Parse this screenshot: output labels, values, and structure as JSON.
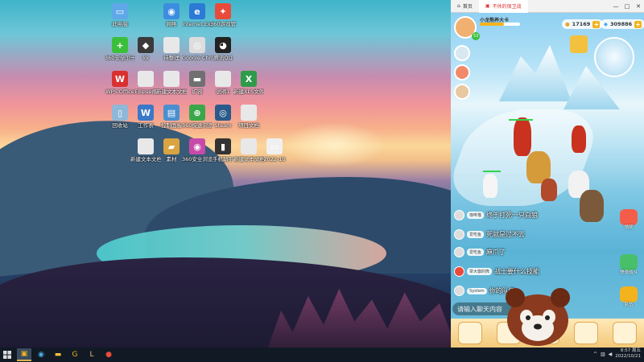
{
  "desktop": {
    "icons": [
      {
        "label": "此电脑",
        "color": "#5fa8e8",
        "glyph": "▭"
      },
      {
        "label": "网络",
        "color": "#3c8de0",
        "glyph": "◉"
      },
      {
        "label": "Internet Explorer",
        "color": "#2b7ad6",
        "glyph": "e"
      },
      {
        "label": "360游戏管",
        "color": "#e84b3c",
        "glyph": "✦"
      },
      {
        "label": "360安全卫士",
        "color": "#3bbf3b",
        "glyph": "+"
      },
      {
        "label": "lol",
        "color": "#3a3a3a",
        "glyph": "◆"
      },
      {
        "label": "待整理",
        "color": "#e8e8e8",
        "glyph": ""
      },
      {
        "label": "Google Chrome",
        "color": "#dddddd",
        "glyph": "◎"
      },
      {
        "label": "腾讯QQ",
        "color": "#222222",
        "glyph": "◕"
      },
      {
        "label": "WPS Office",
        "color": "#d93030",
        "glyph": "W"
      },
      {
        "label": "Ellipse视",
        "color": "#e8e8e8",
        "glyph": ""
      },
      {
        "label": "新建文本文档",
        "color": "#e8e8e8",
        "glyph": ""
      },
      {
        "label": "扩容",
        "color": "#707070",
        "glyph": "▬"
      },
      {
        "label": "说明1",
        "color": "#e8e8e8",
        "glyph": ""
      },
      {
        "label": "新建XLS文件",
        "color": "#2e9b4a",
        "glyph": "X"
      },
      {
        "label": "回收站",
        "color": "#8fb8d8",
        "glyph": "▯"
      },
      {
        "label": "工作表",
        "color": "#3a78c8",
        "glyph": "W"
      },
      {
        "label": "控制面板",
        "color": "#4a8fd0",
        "glyph": "▤"
      },
      {
        "label": "360极速浏览器",
        "color": "#3aa84a",
        "glyph": "⊕"
      },
      {
        "label": "Steam",
        "color": "#2a5a8a",
        "glyph": "◎"
      },
      {
        "label": "项目文档",
        "color": "#e8e8e8",
        "glyph": ""
      },
      {
        "label": "新建文本文档",
        "color": "#e8e8e8",
        "glyph": ""
      },
      {
        "label": "素材",
        "color": "#d9a441",
        "glyph": "▰"
      },
      {
        "label": "360安全浏览器",
        "color": "#c84aa8",
        "glyph": "◉"
      },
      {
        "label": "手机助手",
        "color": "#333333",
        "glyph": "▮"
      },
      {
        "label": "新建文本文档",
        "color": "#e8e8e8",
        "glyph": ""
      },
      {
        "label": "2022-10",
        "color": "#f0f0f0",
        "glyph": "▭"
      }
    ]
  },
  "taskbar": {
    "start_icon": "windows-logo",
    "apps": [
      "G",
      "L"
    ],
    "tray": {
      "time": "8:57",
      "day": "周五",
      "date": "2022/10/21"
    }
  },
  "game_window": {
    "tabs": [
      {
        "label": "首页"
      },
      {
        "label": "不休的保卫战"
      }
    ],
    "window_controls": [
      "—",
      "□",
      "✕"
    ],
    "player": {
      "name": "小龙熊养大卡",
      "level": "53"
    },
    "gold": "17169",
    "diamonds": "309886",
    "side_buttons": [
      {
        "label": "领奖"
      },
      {
        "label": "快速战斗"
      },
      {
        "label": "队伍"
      }
    ],
    "chat": [
      {
        "name": "咖啡猫",
        "message": "终于打死一只白狼"
      },
      {
        "name": "爱吃鱼",
        "message": "死就是过不去"
      },
      {
        "name": "爱吃鱼",
        "message": "麻爪了"
      },
      {
        "name": "举大旗的熊",
        "message": "战士要什么技能"
      },
      {
        "name": "System",
        "message": "你的队伍"
      }
    ],
    "chat_placeholder": "请输入聊天内容",
    "accent": "#f3b31d"
  }
}
